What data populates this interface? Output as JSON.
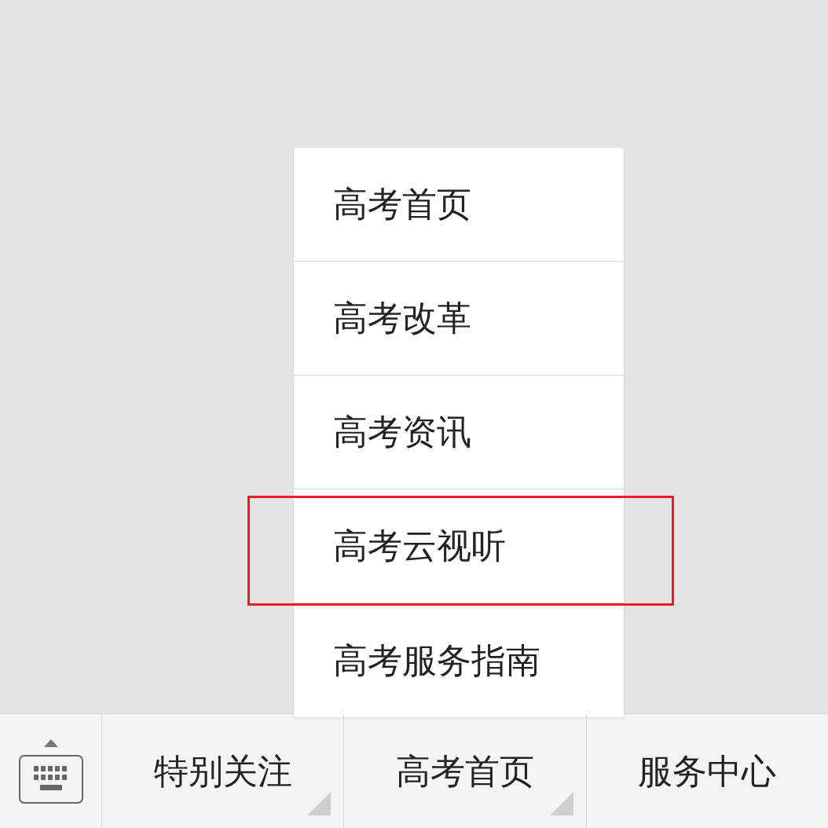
{
  "popup_menu": {
    "items": [
      {
        "label": "高考首页",
        "highlighted": false
      },
      {
        "label": "高考改革",
        "highlighted": false
      },
      {
        "label": "高考资讯",
        "highlighted": false
      },
      {
        "label": "高考云视听",
        "highlighted": true
      },
      {
        "label": "高考服务指南",
        "highlighted": false
      }
    ]
  },
  "bottom_menu": {
    "items": [
      {
        "label": "特别关注",
        "has_submenu": true
      },
      {
        "label": "高考首页",
        "has_submenu": true
      },
      {
        "label": "服务中心",
        "has_submenu": false
      }
    ]
  }
}
